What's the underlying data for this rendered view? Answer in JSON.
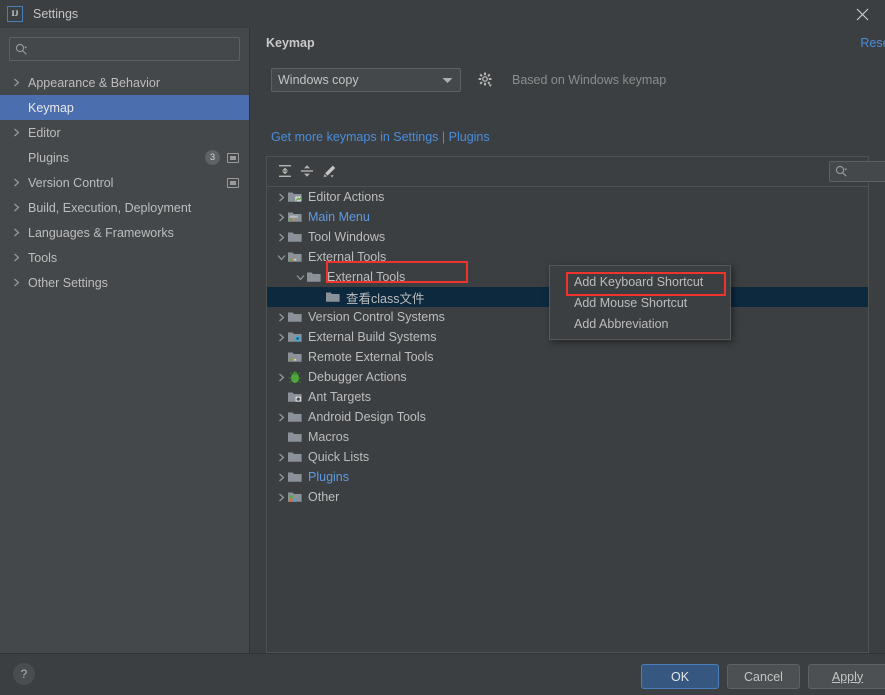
{
  "window": {
    "title": "Settings",
    "logo_text": "IJ",
    "close_label": "×"
  },
  "sidebar": {
    "search_placeholder": "",
    "items": [
      {
        "label": "Appearance & Behavior",
        "expandable": true,
        "selected": false
      },
      {
        "label": "Keymap",
        "expandable": false,
        "selected": true
      },
      {
        "label": "Editor",
        "expandable": true,
        "selected": false
      },
      {
        "label": "Plugins",
        "expandable": false,
        "selected": false,
        "badge": "3",
        "has_box": true
      },
      {
        "label": "Version Control",
        "expandable": true,
        "selected": false,
        "has_box": true
      },
      {
        "label": "Build, Execution, Deployment",
        "expandable": true,
        "selected": false
      },
      {
        "label": "Languages & Frameworks",
        "expandable": true,
        "selected": false
      },
      {
        "label": "Tools",
        "expandable": true,
        "selected": false
      },
      {
        "label": "Other Settings",
        "expandable": true,
        "selected": false
      }
    ]
  },
  "panel": {
    "title": "Keymap",
    "reset_label": "Reset",
    "keymap_selected": "Windows copy",
    "based_on": "Based on Windows keymap",
    "get_more_prefix": "Get more keymaps in Settings",
    "get_more_sep": " | ",
    "get_more_link": "Plugins",
    "tree_search_placeholder": ""
  },
  "tree": {
    "rows": [
      {
        "label": "Editor Actions",
        "indent": 0,
        "arrow": "right",
        "icon": "folder-editor",
        "blue": false,
        "selected": false
      },
      {
        "label": "Main Menu",
        "indent": 0,
        "arrow": "right",
        "icon": "folder-menu",
        "blue": true,
        "selected": false
      },
      {
        "label": "Tool Windows",
        "indent": 0,
        "arrow": "right",
        "icon": "folder",
        "blue": false,
        "selected": false
      },
      {
        "label": "External Tools",
        "indent": 0,
        "arrow": "down",
        "icon": "folder-tools",
        "blue": false,
        "selected": false
      },
      {
        "label": "External Tools",
        "indent": 1,
        "arrow": "down",
        "icon": "folder",
        "blue": false,
        "selected": false
      },
      {
        "label": "查看class文件",
        "indent": 2,
        "arrow": "none",
        "icon": "folder",
        "blue": false,
        "selected": true
      },
      {
        "label": "Version Control Systems",
        "indent": 0,
        "arrow": "right",
        "icon": "folder",
        "blue": false,
        "selected": false
      },
      {
        "label": "External Build Systems",
        "indent": 0,
        "arrow": "right",
        "icon": "folder-build",
        "blue": false,
        "selected": false
      },
      {
        "label": "Remote External Tools",
        "indent": 0,
        "arrow": "none",
        "icon": "folder-tools",
        "blue": false,
        "selected": false
      },
      {
        "label": "Debugger Actions",
        "indent": 0,
        "arrow": "right",
        "icon": "bug",
        "blue": false,
        "selected": false
      },
      {
        "label": "Ant Targets",
        "indent": 0,
        "arrow": "none",
        "icon": "folder-ant",
        "blue": false,
        "selected": false
      },
      {
        "label": "Android Design Tools",
        "indent": 0,
        "arrow": "right",
        "icon": "folder",
        "blue": false,
        "selected": false
      },
      {
        "label": "Macros",
        "indent": 0,
        "arrow": "none",
        "icon": "folder",
        "blue": false,
        "selected": false
      },
      {
        "label": "Quick Lists",
        "indent": 0,
        "arrow": "right",
        "icon": "folder",
        "blue": false,
        "selected": false
      },
      {
        "label": "Plugins",
        "indent": 0,
        "arrow": "right",
        "icon": "folder",
        "blue": true,
        "selected": false
      },
      {
        "label": "Other",
        "indent": 0,
        "arrow": "right",
        "icon": "folder-other",
        "blue": false,
        "selected": false
      }
    ]
  },
  "context_menu": {
    "items": [
      {
        "label": "Add Keyboard Shortcut",
        "highlighted": true
      },
      {
        "label": "Add Mouse Shortcut",
        "highlighted": false
      },
      {
        "label": "Add Abbreviation",
        "highlighted": false
      }
    ]
  },
  "footer": {
    "help_label": "?",
    "ok_label": "OK",
    "cancel_label": "Cancel",
    "apply_label": "Apply"
  },
  "colors": {
    "window_bg": "#3c3f41",
    "sidebar_bg": "#45484a",
    "selection_blue": "#4b6eaf",
    "tree_selection": "#0d293e",
    "link_blue": "#4a8ddc",
    "annotation_red": "#f0332d",
    "ok_button": "#365880"
  }
}
